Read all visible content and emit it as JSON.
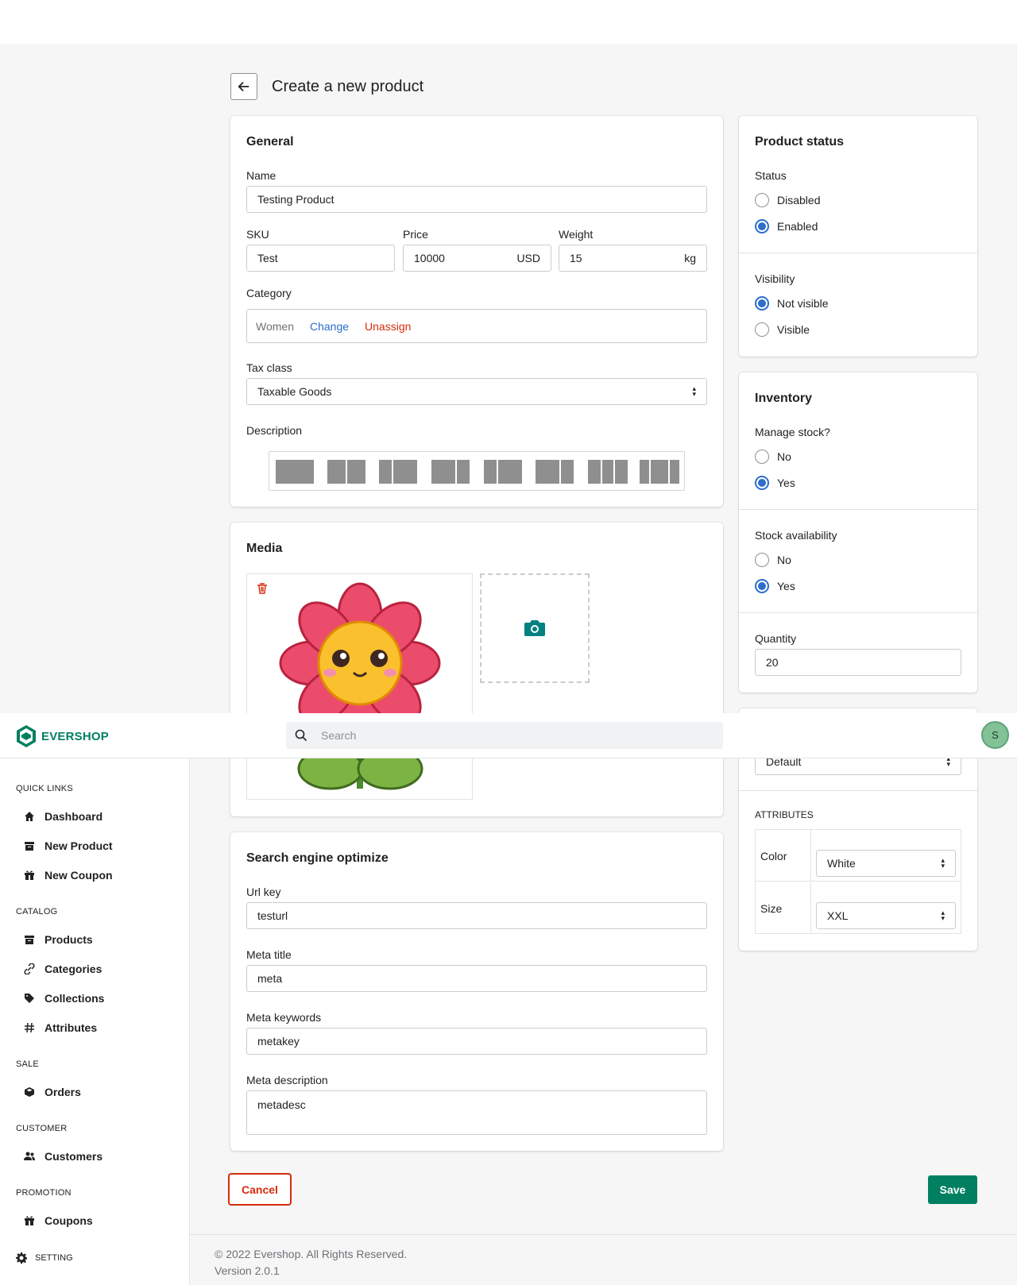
{
  "page": {
    "title": "Create a new product"
  },
  "general": {
    "title": "General",
    "name_label": "Name",
    "name_value": "Testing Product",
    "sku_label": "SKU",
    "sku_value": "Test",
    "price_label": "Price",
    "price_value": "10000",
    "price_suffix": "USD",
    "weight_label": "Weight",
    "weight_value": "15",
    "weight_suffix": "kg",
    "category_label": "Category",
    "category_value": "Women",
    "category_change": "Change",
    "category_unassign": "Unassign",
    "tax_label": "Tax class",
    "tax_value": "Taxable Goods",
    "description_label": "Description"
  },
  "media": {
    "title": "Media"
  },
  "seo": {
    "title": "Search engine optimize",
    "url_label": "Url key",
    "url_value": "testurl",
    "meta_title_label": "Meta title",
    "meta_title_value": "meta",
    "meta_keywords_label": "Meta keywords",
    "meta_keywords_value": "metakey",
    "meta_description_label": "Meta description",
    "meta_description_value": "metadesc"
  },
  "status": {
    "title": "Product status",
    "status_label": "Status",
    "disabled": "Disabled",
    "enabled": "Enabled",
    "visibility_label": "Visibility",
    "not_visible": "Not visible",
    "visible": "Visible"
  },
  "inventory": {
    "title": "Inventory",
    "manage_label": "Manage stock?",
    "no": "No",
    "yes": "Yes",
    "availability_label": "Stock availability",
    "quantity_label": "Quantity",
    "quantity_value": "20"
  },
  "attributes": {
    "group_value": "Default",
    "title": "ATTRIBUTES",
    "color_label": "Color",
    "color_value": "White",
    "size_label": "Size",
    "size_value": "XXL"
  },
  "topbar": {
    "brand": "EVERSHOP",
    "search_placeholder": "Search",
    "avatar_letter": "S"
  },
  "sidebar": {
    "quick_links": "QUICK LINKS",
    "dashboard": "Dashboard",
    "new_product": "New Product",
    "new_coupon": "New Coupon",
    "catalog": "CATALOG",
    "products": "Products",
    "categories": "Categories",
    "collections": "Collections",
    "attributes": "Attributes",
    "sale": "SALE",
    "orders": "Orders",
    "customer": "CUSTOMER",
    "customers": "Customers",
    "promotion": "PROMOTION",
    "coupons": "Coupons",
    "setting": "SETTING"
  },
  "actions": {
    "cancel": "Cancel",
    "save": "Save"
  },
  "footer": {
    "copyright": "© 2022 Evershop. All Rights Reserved.",
    "version": "Version 2.0.1"
  },
  "colors": {
    "accent": "#008060",
    "radio": "#2c6ecb",
    "danger": "#d72c0d",
    "link": "#2c6ecb"
  }
}
